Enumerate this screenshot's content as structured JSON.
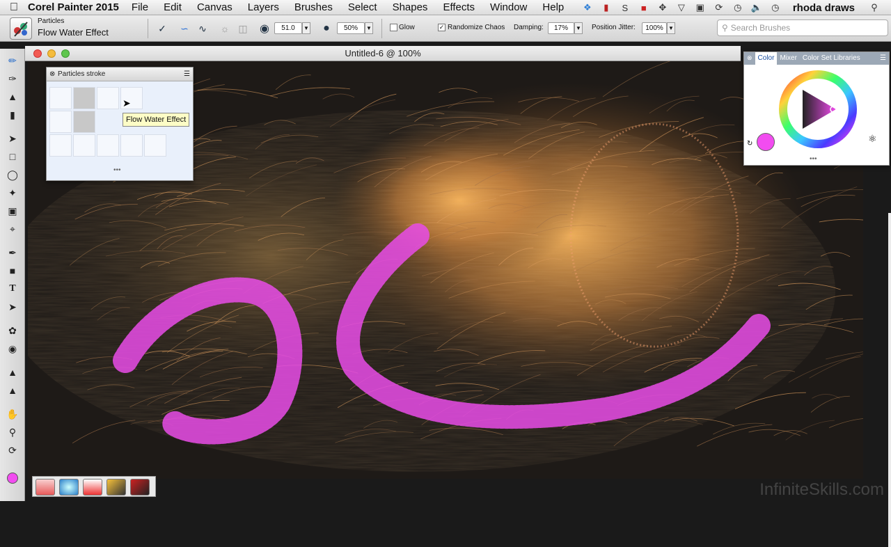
{
  "menubar": {
    "app_name": "Corel Painter 2015",
    "menus": [
      "File",
      "Edit",
      "Canvas",
      "Layers",
      "Brushes",
      "Select",
      "Shapes",
      "Effects",
      "Window",
      "Help"
    ],
    "user": "rhoda draws"
  },
  "propbar": {
    "category": "Particles",
    "variant": "Flow Water Effect",
    "size_value": "51.0",
    "opacity_value": "50%",
    "glow_label": "Glow",
    "glow_checked": false,
    "randomize_label": "Randomize Chaos",
    "randomize_checked": true,
    "damping_label": "Damping:",
    "damping_value": "17%",
    "jitter_label": "Position Jitter:",
    "jitter_value": "100%",
    "search_placeholder": "Search Brushes"
  },
  "document": {
    "title": "Untitled-6 @ 100%"
  },
  "particles_panel": {
    "title": "Particles stroke",
    "tooltip": "Flow Water Effect"
  },
  "color_panel": {
    "tabs": [
      "Color",
      "Mixer",
      "Color Set Libraries"
    ],
    "current_color": "#f24cf0"
  },
  "watermark": "InfiniteSkills.com"
}
